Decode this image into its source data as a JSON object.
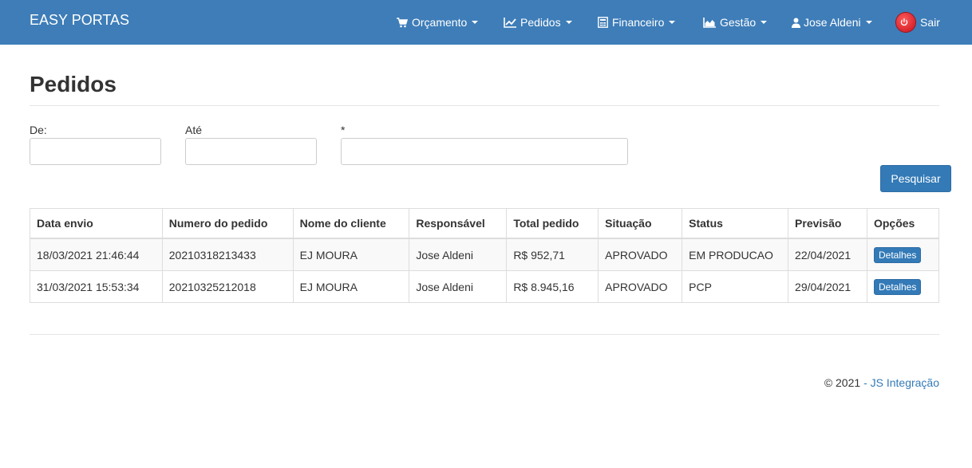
{
  "navbar": {
    "brand": "EASY PORTAS",
    "items": [
      {
        "label": "Orçamento",
        "icon": "cart-icon"
      },
      {
        "label": "Pedidos",
        "icon": "line-chart-icon"
      },
      {
        "label": "Financeiro",
        "icon": "calculator-icon"
      },
      {
        "label": "Gestão",
        "icon": "area-chart-icon"
      },
      {
        "label": "Jose Aldeni",
        "icon": "user-icon"
      }
    ],
    "logout": {
      "label": "Sair",
      "icon": "power-icon"
    }
  },
  "page": {
    "title": "Pedidos"
  },
  "filters": {
    "from_label": "De:",
    "from_value": "",
    "to_label": "Até",
    "to_value": "",
    "text_label": "*",
    "text_value": "",
    "search_button": "Pesquisar"
  },
  "table": {
    "headers": [
      "Data envio",
      "Numero do pedido",
      "Nome do cliente",
      "Responsável",
      "Total pedido",
      "Situação",
      "Status",
      "Previsão",
      "Opções"
    ],
    "rows": [
      {
        "data_envio": "18/03/2021 21:46:44",
        "numero": "20210318213433",
        "cliente": "EJ MOURA",
        "responsavel": "Jose Aldeni",
        "total": "R$ 952,71",
        "situacao": "APROVADO",
        "status": "EM PRODUCAO",
        "previsao": "22/04/2021",
        "acao": "Detalhes"
      },
      {
        "data_envio": "31/03/2021 15:53:34",
        "numero": "20210325212018",
        "cliente": "EJ MOURA",
        "responsavel": "Jose Aldeni",
        "total": "R$ 8.945,16",
        "situacao": "APROVADO",
        "status": "PCP",
        "previsao": "29/04/2021",
        "acao": "Detalhes"
      }
    ]
  },
  "footer": {
    "copyright": "© 2021",
    "link": "- JS Integração"
  },
  "colors": {
    "navbar": "#3e7db8",
    "primary": "#337ab7",
    "power": "#e0101a"
  }
}
